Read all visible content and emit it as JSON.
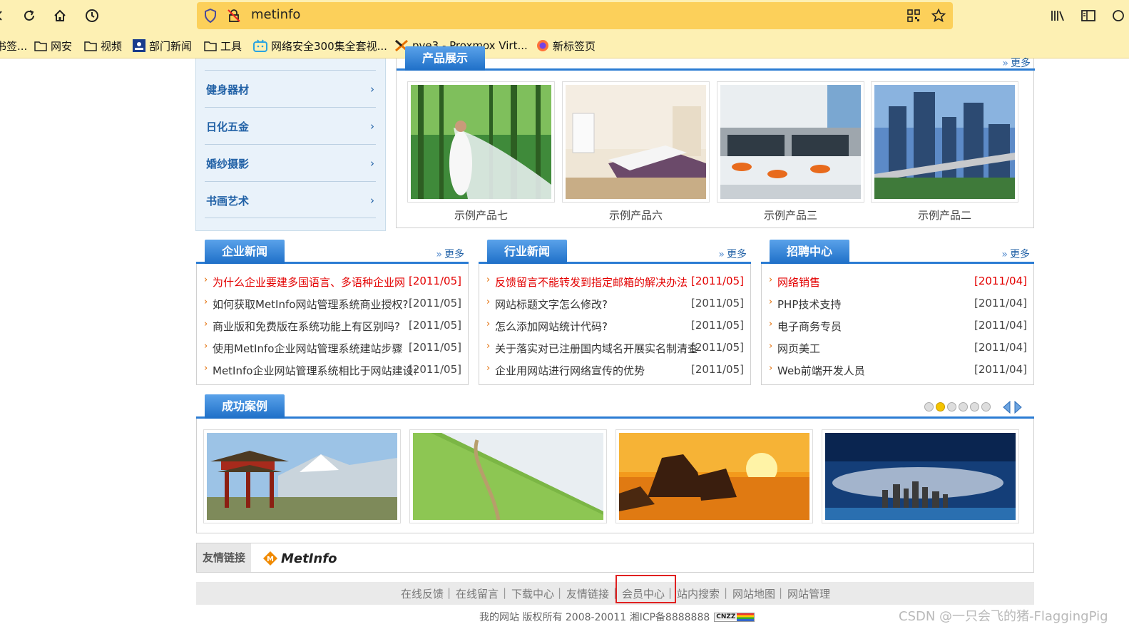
{
  "browser": {
    "url": "metinfo",
    "bookmarks": [
      "书签...",
      "网安",
      "视频",
      "部门新闻",
      "工具",
      "网络安全300集全套视...",
      "pve3 - Proxmox Virt...",
      "新标签页"
    ]
  },
  "sidebar": {
    "items": [
      {
        "label": "健身器材"
      },
      {
        "label": "日化五金"
      },
      {
        "label": "婚纱摄影"
      },
      {
        "label": "书画艺术"
      }
    ]
  },
  "products": {
    "title": "产品展示",
    "more": "更多",
    "items": [
      {
        "caption": "示例产品七"
      },
      {
        "caption": "示例产品六"
      },
      {
        "caption": "示例产品三"
      },
      {
        "caption": "示例产品二"
      }
    ]
  },
  "company_news": {
    "title": "企业新闻",
    "more": "更多",
    "items": [
      {
        "text": "为什么企业要建多国语言、多语种企业网",
        "date": "[2011/05]"
      },
      {
        "text": "如何获取MetInfo网站管理系统商业授权?",
        "date": "[2011/05]"
      },
      {
        "text": "商业版和免费版在系统功能上有区别吗?",
        "date": "[2011/05]"
      },
      {
        "text": "使用MetInfo企业网站管理系统建站步骤",
        "date": "[2011/05]"
      },
      {
        "text": "MetInfo企业网站管理系统相比于网站建设公",
        "date": "[2011/05]"
      }
    ]
  },
  "industry_news": {
    "title": "行业新闻",
    "more": "更多",
    "items": [
      {
        "text": "反馈留言不能转发到指定邮箱的解决办法",
        "date": "[2011/05]"
      },
      {
        "text": "网站标题文字怎么修改?",
        "date": "[2011/05]"
      },
      {
        "text": "怎么添加网站统计代码?",
        "date": "[2011/05]"
      },
      {
        "text": "关于落实对已注册国内域名开展实名制清查",
        "date": "[2011/05]"
      },
      {
        "text": "企业用网站进行网络宣传的优势",
        "date": "[2011/05]"
      }
    ]
  },
  "jobs": {
    "title": "招聘中心",
    "more": "更多",
    "items": [
      {
        "text": "网络销售",
        "date": "[2011/04]"
      },
      {
        "text": "PHP技术支持",
        "date": "[2011/04]"
      },
      {
        "text": "电子商务专员",
        "date": "[2011/04]"
      },
      {
        "text": "网页美工",
        "date": "[2011/04]"
      },
      {
        "text": "Web前端开发人员",
        "date": "[2011/04]"
      }
    ]
  },
  "cases": {
    "title": "成功案例",
    "active_dot": 2,
    "dot_count": 6
  },
  "friend_links": {
    "label": "友情链接",
    "logo_text": "MetInfo"
  },
  "footer": {
    "links": [
      "在线反馈",
      "在线留言",
      "下载中心",
      "友情链接",
      "会员中心",
      "站内搜索",
      "网站地图",
      "网站管理"
    ],
    "copyright": "我的网站 版权所有 2008-20011 湘ICP备8888888",
    "badge": "CNZZ"
  },
  "watermark": "CSDN @一只会飞的猪-FlaggingPig"
}
